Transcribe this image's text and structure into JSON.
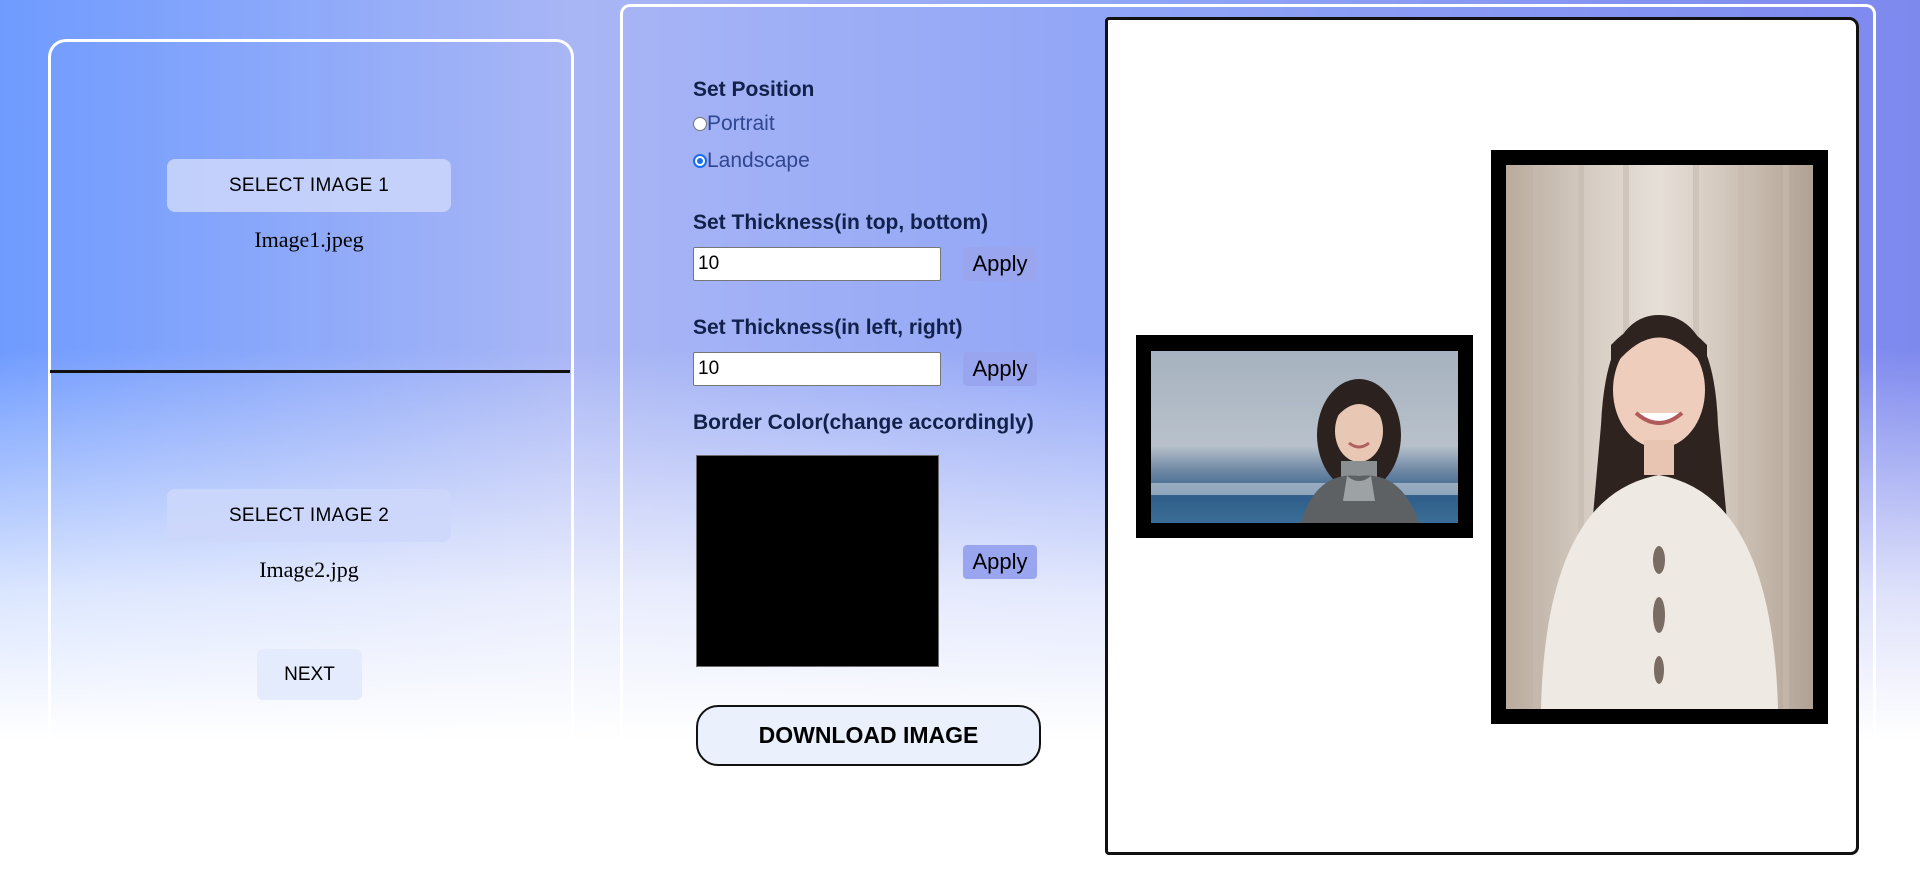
{
  "left_panel": {
    "select_image_1_label": "SELECT IMAGE 1",
    "image_1_filename": "Image1.jpeg",
    "select_image_2_label": "SELECT IMAGE 2",
    "image_2_filename": "Image2.jpg",
    "next_label": "NEXT"
  },
  "settings": {
    "position": {
      "heading": "Set Position",
      "options": [
        "Portrait",
        "Landscape"
      ],
      "selected": "Landscape"
    },
    "thickness_top_bottom": {
      "heading": "Set Thickness(in top, bottom)",
      "value": "10",
      "apply_label": "Apply"
    },
    "thickness_left_right": {
      "heading": "Set Thickness(in left, right)",
      "value": "10",
      "apply_label": "Apply"
    },
    "border_color": {
      "heading": "Border Color(change accordingly)",
      "color": "#000000",
      "apply_label": "Apply"
    },
    "download_label": "DOWNLOAD IMAGE"
  },
  "preview": {
    "background": "#ffffff",
    "border_color": "#000000",
    "image_1": "landscape photo of smiling woman with long dark hair by the sea",
    "image_2": "portrait photo of smiling woman in white sweater in front of curtain"
  },
  "colors": {
    "apply_button": "#9aa5ef",
    "select_button": "#cdd7fa",
    "heading_text": "#11214a",
    "radio_text": "#2f4690",
    "radio_accent": "#1a6cf0"
  }
}
